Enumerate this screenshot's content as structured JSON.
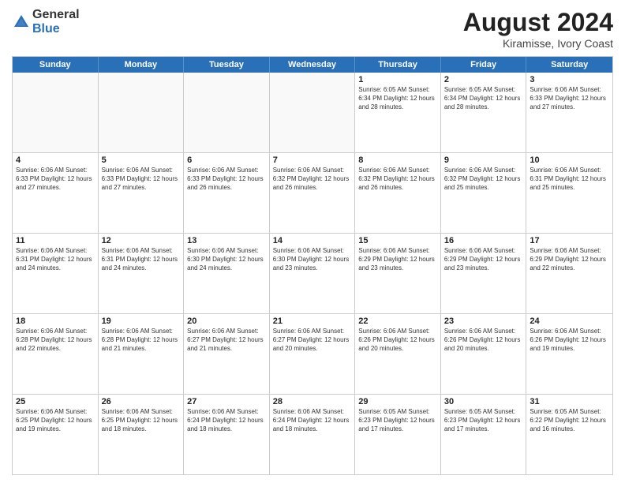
{
  "header": {
    "logo_general": "General",
    "logo_blue": "Blue",
    "main_title": "August 2024",
    "subtitle": "Kiramisse, Ivory Coast"
  },
  "calendar": {
    "days_of_week": [
      "Sunday",
      "Monday",
      "Tuesday",
      "Wednesday",
      "Thursday",
      "Friday",
      "Saturday"
    ],
    "rows": [
      [
        {
          "day": "",
          "empty": true
        },
        {
          "day": "",
          "empty": true
        },
        {
          "day": "",
          "empty": true
        },
        {
          "day": "",
          "empty": true
        },
        {
          "day": "1",
          "info": "Sunrise: 6:05 AM\nSunset: 6:34 PM\nDaylight: 12 hours\nand 28 minutes."
        },
        {
          "day": "2",
          "info": "Sunrise: 6:05 AM\nSunset: 6:34 PM\nDaylight: 12 hours\nand 28 minutes."
        },
        {
          "day": "3",
          "info": "Sunrise: 6:06 AM\nSunset: 6:33 PM\nDaylight: 12 hours\nand 27 minutes."
        }
      ],
      [
        {
          "day": "4",
          "info": "Sunrise: 6:06 AM\nSunset: 6:33 PM\nDaylight: 12 hours\nand 27 minutes."
        },
        {
          "day": "5",
          "info": "Sunrise: 6:06 AM\nSunset: 6:33 PM\nDaylight: 12 hours\nand 27 minutes."
        },
        {
          "day": "6",
          "info": "Sunrise: 6:06 AM\nSunset: 6:33 PM\nDaylight: 12 hours\nand 26 minutes."
        },
        {
          "day": "7",
          "info": "Sunrise: 6:06 AM\nSunset: 6:32 PM\nDaylight: 12 hours\nand 26 minutes."
        },
        {
          "day": "8",
          "info": "Sunrise: 6:06 AM\nSunset: 6:32 PM\nDaylight: 12 hours\nand 26 minutes."
        },
        {
          "day": "9",
          "info": "Sunrise: 6:06 AM\nSunset: 6:32 PM\nDaylight: 12 hours\nand 25 minutes."
        },
        {
          "day": "10",
          "info": "Sunrise: 6:06 AM\nSunset: 6:31 PM\nDaylight: 12 hours\nand 25 minutes."
        }
      ],
      [
        {
          "day": "11",
          "info": "Sunrise: 6:06 AM\nSunset: 6:31 PM\nDaylight: 12 hours\nand 24 minutes."
        },
        {
          "day": "12",
          "info": "Sunrise: 6:06 AM\nSunset: 6:31 PM\nDaylight: 12 hours\nand 24 minutes."
        },
        {
          "day": "13",
          "info": "Sunrise: 6:06 AM\nSunset: 6:30 PM\nDaylight: 12 hours\nand 24 minutes."
        },
        {
          "day": "14",
          "info": "Sunrise: 6:06 AM\nSunset: 6:30 PM\nDaylight: 12 hours\nand 23 minutes."
        },
        {
          "day": "15",
          "info": "Sunrise: 6:06 AM\nSunset: 6:29 PM\nDaylight: 12 hours\nand 23 minutes."
        },
        {
          "day": "16",
          "info": "Sunrise: 6:06 AM\nSunset: 6:29 PM\nDaylight: 12 hours\nand 23 minutes."
        },
        {
          "day": "17",
          "info": "Sunrise: 6:06 AM\nSunset: 6:29 PM\nDaylight: 12 hours\nand 22 minutes."
        }
      ],
      [
        {
          "day": "18",
          "info": "Sunrise: 6:06 AM\nSunset: 6:28 PM\nDaylight: 12 hours\nand 22 minutes."
        },
        {
          "day": "19",
          "info": "Sunrise: 6:06 AM\nSunset: 6:28 PM\nDaylight: 12 hours\nand 21 minutes."
        },
        {
          "day": "20",
          "info": "Sunrise: 6:06 AM\nSunset: 6:27 PM\nDaylight: 12 hours\nand 21 minutes."
        },
        {
          "day": "21",
          "info": "Sunrise: 6:06 AM\nSunset: 6:27 PM\nDaylight: 12 hours\nand 20 minutes."
        },
        {
          "day": "22",
          "info": "Sunrise: 6:06 AM\nSunset: 6:26 PM\nDaylight: 12 hours\nand 20 minutes."
        },
        {
          "day": "23",
          "info": "Sunrise: 6:06 AM\nSunset: 6:26 PM\nDaylight: 12 hours\nand 20 minutes."
        },
        {
          "day": "24",
          "info": "Sunrise: 6:06 AM\nSunset: 6:26 PM\nDaylight: 12 hours\nand 19 minutes."
        }
      ],
      [
        {
          "day": "25",
          "info": "Sunrise: 6:06 AM\nSunset: 6:25 PM\nDaylight: 12 hours\nand 19 minutes."
        },
        {
          "day": "26",
          "info": "Sunrise: 6:06 AM\nSunset: 6:25 PM\nDaylight: 12 hours\nand 18 minutes."
        },
        {
          "day": "27",
          "info": "Sunrise: 6:06 AM\nSunset: 6:24 PM\nDaylight: 12 hours\nand 18 minutes."
        },
        {
          "day": "28",
          "info": "Sunrise: 6:06 AM\nSunset: 6:24 PM\nDaylight: 12 hours\nand 18 minutes."
        },
        {
          "day": "29",
          "info": "Sunrise: 6:05 AM\nSunset: 6:23 PM\nDaylight: 12 hours\nand 17 minutes."
        },
        {
          "day": "30",
          "info": "Sunrise: 6:05 AM\nSunset: 6:23 PM\nDaylight: 12 hours\nand 17 minutes."
        },
        {
          "day": "31",
          "info": "Sunrise: 6:05 AM\nSunset: 6:22 PM\nDaylight: 12 hours\nand 16 minutes."
        }
      ]
    ]
  }
}
